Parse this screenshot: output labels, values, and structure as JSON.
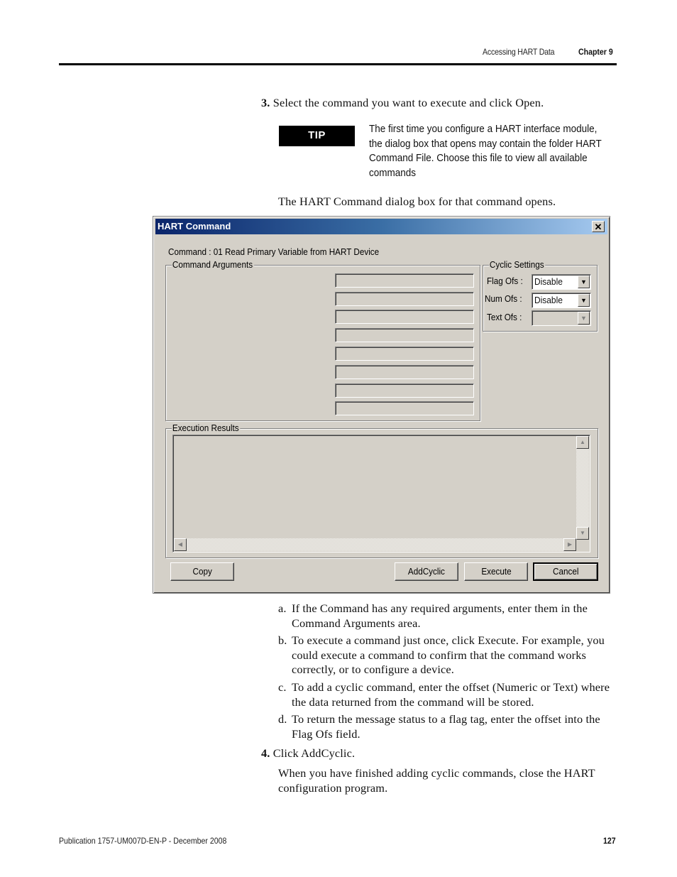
{
  "header": {
    "section": "Accessing HART Data",
    "chapter": "Chapter 9"
  },
  "step3": {
    "number": "3.",
    "text": "Select the command you want to execute and click Open."
  },
  "tip": {
    "badge": "TIP",
    "text": "The first time you configure a HART interface module, the dialog box that opens may contain the folder HART Command File. Choose this file to view all available commands"
  },
  "dialog_intro": "The HART Command dialog box for that command opens.",
  "dialog": {
    "title": "HART Command",
    "close_glyph": "✕",
    "command_line": "Command : 01 Read Primary Variable from HART Device",
    "command_arguments": {
      "legend": "Command Arguments",
      "fields": [
        "",
        "",
        "",
        "",
        "",
        "",
        "",
        ""
      ]
    },
    "cyclic_settings": {
      "legend": "Cyclic Settings",
      "flag_ofs": {
        "label": "Flag Ofs :",
        "value": "Disable",
        "enabled": true
      },
      "num_ofs": {
        "label": "Num Ofs :",
        "value": "Disable",
        "enabled": true
      },
      "text_ofs": {
        "label": "Text Ofs :",
        "value": "",
        "enabled": false
      }
    },
    "execution_results": {
      "legend": "Execution Results",
      "content": ""
    },
    "buttons": {
      "copy": "Copy",
      "add_cyclic": "AddCyclic",
      "execute": "Execute",
      "cancel": "Cancel"
    }
  },
  "sub_steps": [
    {
      "letter": "a.",
      "text": "If the Command has any required arguments, enter them in the Command Arguments area."
    },
    {
      "letter": "b.",
      "text": "To execute a command just once, click Execute. For example, you could execute a command to confirm that the command works correctly, or to configure a device."
    },
    {
      "letter": "c.",
      "text": "To add a cyclic command, enter the offset (Numeric or Text) where the data returned from the command will be stored."
    },
    {
      "letter": "d.",
      "text": "To return the message status to a flag tag, enter the offset into the Flag Ofs field."
    }
  ],
  "step4": {
    "number": "4.",
    "text": "Click AddCyclic."
  },
  "closing_text": "When you have finished adding cyclic commands, close the HART configuration program.",
  "footer": {
    "publication": "Publication 1757-UM007D-EN-P - December 2008",
    "page": "127"
  }
}
